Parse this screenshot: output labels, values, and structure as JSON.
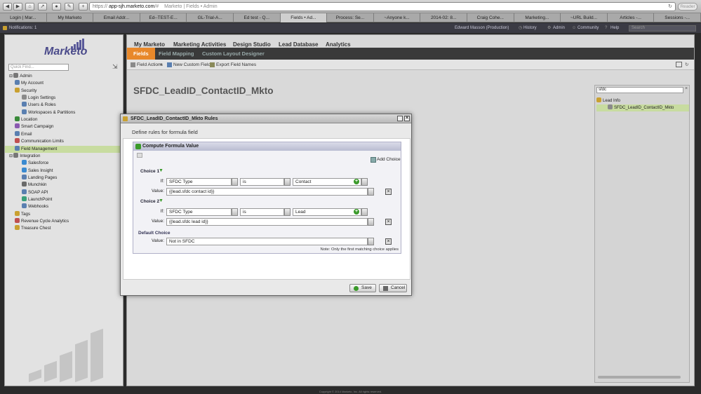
{
  "browser": {
    "url_scheme": "https",
    "url_host": "app-sjh.marketo.com",
    "url_rest": "/#",
    "page_title": "Marketo | Fields • Admin",
    "reader_label": "Reader",
    "tabs": [
      "Login | Mar...",
      "My Marketo",
      "Email Addr...",
      "Ed--TEST-E...",
      "GL-Trial-A...",
      "Ed test - Q...",
      "Fields • Ad...",
      "Process: Se...",
      "~Anyone k...",
      "2014-02: 8...",
      "Craig Cohe...",
      "Marketing...",
      "~URL Build...",
      "Articles -...",
      "Sessions -..."
    ]
  },
  "mktbar": {
    "notifications": "Notifications: 1",
    "user": "Edward Masson (Production)",
    "history": "History",
    "admin": "Admin",
    "community": "Community",
    "help": "Help",
    "search_placeholder": "Search"
  },
  "left": {
    "logo": "Marketo",
    "quick_find_placeholder": "Quick Find...",
    "tree": [
      {
        "label": "Admin",
        "indent": 1,
        "color": "#777"
      },
      {
        "label": "My Account",
        "indent": 2,
        "color": "#5a7fb0"
      },
      {
        "label": "Security",
        "indent": 2,
        "color": "#c9a030"
      },
      {
        "label": "Login Settings",
        "indent": 3,
        "color": "#8a8a8a"
      },
      {
        "label": "Users & Roles",
        "indent": 3,
        "color": "#5a7fb0"
      },
      {
        "label": "Workspaces & Partitions",
        "indent": 3,
        "color": "#5a7fb0"
      },
      {
        "label": "Location",
        "indent": 2,
        "color": "#3a8a3a"
      },
      {
        "label": "Smart Campaign",
        "indent": 2,
        "color": "#8a5ab0"
      },
      {
        "label": "Email",
        "indent": 2,
        "color": "#5a7fb0"
      },
      {
        "label": "Communication Limits",
        "indent": 2,
        "color": "#c05050"
      },
      {
        "label": "Field Management",
        "indent": 2,
        "color": "#5a7fb0",
        "selected": true
      },
      {
        "label": "Integration",
        "indent": 1,
        "color": "#777"
      },
      {
        "label": "Salesforce",
        "indent": 3,
        "color": "#3a8ad0"
      },
      {
        "label": "Sales Insight",
        "indent": 3,
        "color": "#3a8ad0"
      },
      {
        "label": "Landing Pages",
        "indent": 3,
        "color": "#5a7fb0"
      },
      {
        "label": "Munchkin",
        "indent": 3,
        "color": "#6a6a6a"
      },
      {
        "label": "SOAP API",
        "indent": 3,
        "color": "#5a7fb0"
      },
      {
        "label": "LaunchPoint",
        "indent": 3,
        "color": "#3aa07a"
      },
      {
        "label": "Webhooks",
        "indent": 3,
        "color": "#5a7fb0"
      },
      {
        "label": "Tags",
        "indent": 2,
        "color": "#c9a030"
      },
      {
        "label": "Revenue Cycle Analytics",
        "indent": 2,
        "color": "#c05050"
      },
      {
        "label": "Treasure Chest",
        "indent": 2,
        "color": "#c9a030"
      }
    ]
  },
  "main": {
    "top_menu": [
      "My Marketo",
      "Marketing Activities",
      "Design Studio",
      "Lead Database",
      "Analytics"
    ],
    "sub_tabs": [
      "Fields",
      "Field Mapping",
      "Custom Layout Designer"
    ],
    "actions": [
      "Field Actions",
      "New Custom Field",
      "Export Field Names"
    ],
    "field_title": "SFDC_LeadID_ContactID_Mkto",
    "side_search_value": "sfdc",
    "side_tree_group": "Lead Info",
    "side_tree_item": "SFDC_LeadID_ContactID_Mkto"
  },
  "dialog": {
    "title": "SFDC_LeadID_ContactID_Mkto Rules",
    "subtitle": "Define rules for formula field",
    "section_title": "Compute Formula Value",
    "add_choice": "Add Choice",
    "if_label": "If:",
    "value_label": "Value:",
    "choices": [
      {
        "name": "Choice 1",
        "field": "SFDC Type",
        "operator": "is",
        "match": "Contact",
        "value": "{{lead.sfdc contact id}}"
      },
      {
        "name": "Choice 2",
        "field": "SFDC Type",
        "operator": "is",
        "match": "Lead",
        "value": "{{lead.sfdc lead id}}"
      }
    ],
    "default_label": "Default Choice",
    "default_value": "Not in SFDC",
    "note": "Note: Only the first matching choice applies",
    "save": "Save",
    "cancel": "Cancel"
  },
  "footer": "Copyright © 2014 Marketo, Inc. All rights reserved."
}
